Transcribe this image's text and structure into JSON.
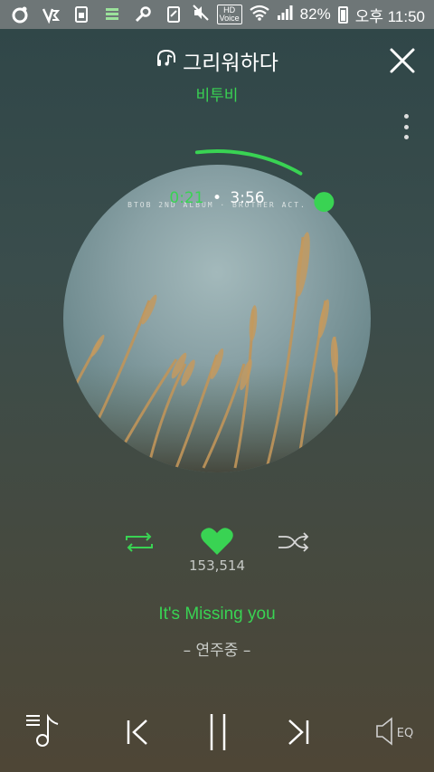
{
  "status_bar": {
    "hd_label": "HD",
    "voice_label": "Voice",
    "battery_percent": "82%",
    "time": "오후 11:50"
  },
  "player": {
    "song_title": "그리워하다",
    "artist": "비투비",
    "album_text": "BTOB 2ND ALBUM · BROTHER ACT.",
    "current_time": "0:21",
    "separator": "•",
    "total_time": "3:56",
    "progress": 0.089,
    "like_count": "153,514",
    "lyric_line": "It's Missing you",
    "state_text": "– 연주중 –",
    "eq_label": "EQ"
  },
  "colors": {
    "accent": "#39d353",
    "status_bar_bg": "#6e7677"
  },
  "icons": [
    "headphone-icon",
    "close-icon",
    "more-icon",
    "repeat-icon",
    "heart-icon",
    "shuffle-icon",
    "playlist-icon",
    "previous-icon",
    "pause-icon",
    "next-icon",
    "eq-icon"
  ]
}
